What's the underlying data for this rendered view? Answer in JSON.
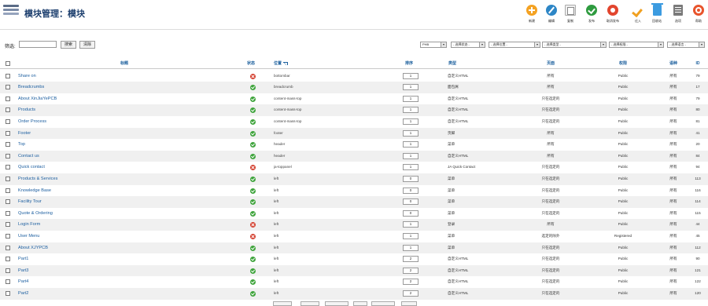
{
  "header": {
    "title": "模块管理：模块"
  },
  "toolbar": [
    {
      "label": "新建",
      "icon": "plus-icon"
    },
    {
      "label": "编辑",
      "icon": "pencil-icon"
    },
    {
      "label": "复制",
      "icon": "copy-icon"
    },
    {
      "label": "发布",
      "icon": "check-icon"
    },
    {
      "label": "取消发布",
      "icon": "unpublish-icon"
    },
    {
      "label": "迁入",
      "icon": "checkin-icon"
    },
    {
      "label": "回收站",
      "icon": "trash-icon"
    },
    {
      "label": "选项",
      "icon": "options-icon"
    },
    {
      "label": "帮助",
      "icon": "help-icon"
    }
  ],
  "filter": {
    "label": "筛选:",
    "search_value": "",
    "search_button": "搜索",
    "clear_button": "清除",
    "selects": [
      "PHB",
      "- 选择状态 -",
      "- 选择位置 -",
      "- 选择类型 -",
      "- 选择权限 -",
      "- 选择语言 -"
    ]
  },
  "columns": {
    "title": "标题",
    "status": "状态",
    "position": "位置",
    "ordering": "排序",
    "type": "类型",
    "pages": "页面",
    "access": "权限",
    "language": "语种",
    "id": "ID"
  },
  "rows": [
    {
      "title": "Share on",
      "status": "unpublished",
      "position": "bottombar",
      "order": "1",
      "type": "自定义HTML",
      "pages": "所有",
      "access": "Public",
      "language": "所有",
      "id": "79"
    },
    {
      "title": "Breadcrumbs",
      "status": "published",
      "position": "breadcrumb",
      "order": "1",
      "type": "面包屑",
      "pages": "所有",
      "access": "Public",
      "language": "所有",
      "id": "17"
    },
    {
      "title": "About XinJiaYePCB",
      "status": "published",
      "position": "content-mass-top",
      "order": "1",
      "type": "自定义HTML",
      "pages": "只在选定的",
      "access": "Public",
      "language": "所有",
      "id": "79"
    },
    {
      "title": "Products",
      "status": "published",
      "position": "content-mass-top",
      "order": "1",
      "type": "自定义HTML",
      "pages": "只在选定的",
      "access": "Public",
      "language": "所有",
      "id": "80"
    },
    {
      "title": "Order Process",
      "status": "published",
      "position": "content-mass-top",
      "order": "1",
      "type": "自定义HTML",
      "pages": "只在选定的",
      "access": "Public",
      "language": "所有",
      "id": "81"
    },
    {
      "title": "Footer",
      "status": "published",
      "position": "footer",
      "order": "1",
      "type": "页脚",
      "pages": "所有",
      "access": "Public",
      "language": "所有",
      "id": "41"
    },
    {
      "title": "Top",
      "status": "published",
      "position": "header",
      "order": "1",
      "type": "菜单",
      "pages": "所有",
      "access": "Public",
      "language": "所有",
      "id": "20"
    },
    {
      "title": "Contact us",
      "status": "published",
      "position": "header",
      "order": "1",
      "type": "自定义HTML",
      "pages": "所有",
      "access": "Public",
      "language": "所有",
      "id": "84"
    },
    {
      "title": "Quick contact",
      "status": "unpublished",
      "position": "ja-toppanel",
      "order": "1",
      "type": "JA Quick Contact",
      "pages": "只在选定的",
      "access": "Public",
      "language": "所有",
      "id": "94"
    },
    {
      "title": "Products & Services",
      "status": "published",
      "position": "left",
      "order": "0",
      "type": "菜单",
      "pages": "只在选定的",
      "access": "Public",
      "language": "所有",
      "id": "113"
    },
    {
      "title": "Knowledge Base",
      "status": "published",
      "position": "left",
      "order": "0",
      "type": "菜单",
      "pages": "只在选定的",
      "access": "Public",
      "language": "所有",
      "id": "116"
    },
    {
      "title": "Facility Tour",
      "status": "published",
      "position": "left",
      "order": "0",
      "type": "菜单",
      "pages": "只在选定的",
      "access": "Public",
      "language": "所有",
      "id": "114"
    },
    {
      "title": "Quote & Ordering",
      "status": "published",
      "position": "left",
      "order": "0",
      "type": "菜单",
      "pages": "只在选定的",
      "access": "Public",
      "language": "所有",
      "id": "115"
    },
    {
      "title": "Login Form",
      "status": "unpublished",
      "position": "left",
      "order": "1",
      "type": "登录",
      "pages": "所有",
      "access": "Public",
      "language": "所有",
      "id": "44"
    },
    {
      "title": "User Menu",
      "status": "unpublished",
      "position": "left",
      "order": "1",
      "type": "菜单",
      "pages": "选定的除外",
      "access": "Registered",
      "language": "所有",
      "id": "45"
    },
    {
      "title": "About XJYPCB",
      "status": "published",
      "position": "left",
      "order": "1",
      "type": "菜单",
      "pages": "只在选定的",
      "access": "Public",
      "language": "所有",
      "id": "112"
    },
    {
      "title": "Part1",
      "status": "published",
      "position": "left",
      "order": "2",
      "type": "自定义HTML",
      "pages": "只在选定的",
      "access": "Public",
      "language": "所有",
      "id": "90"
    },
    {
      "title": "Part3",
      "status": "published",
      "position": "left",
      "order": "2",
      "type": "自定义HTML",
      "pages": "只在选定的",
      "access": "Public",
      "language": "所有",
      "id": "121"
    },
    {
      "title": "Part4",
      "status": "published",
      "position": "left",
      "order": "2",
      "type": "自定义HTML",
      "pages": "只在选定的",
      "access": "Public",
      "language": "所有",
      "id": "122"
    },
    {
      "title": "Part2",
      "status": "published",
      "position": "left",
      "order": "2",
      "type": "自定义HTML",
      "pages": "只在选定的",
      "access": "Public",
      "language": "所有",
      "id": "120"
    }
  ]
}
